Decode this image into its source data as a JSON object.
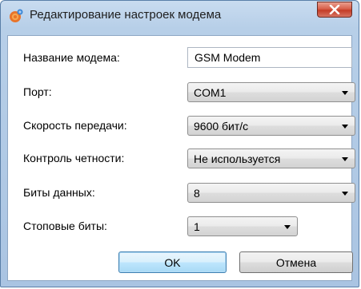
{
  "window": {
    "title": "Редактирование настроек модема",
    "close_icon": "close-x-icon",
    "app_icon": "modem-settings-icon"
  },
  "fields": {
    "modem_name_label": "Название модема:",
    "modem_name_value": "GSM Modem",
    "port_label": "Порт:",
    "port_value": "COM1",
    "baud_label": "Скорость передачи:",
    "baud_value": "9600 бит/с",
    "parity_label": "Контроль четности:",
    "parity_value": "Не используется",
    "data_bits_label": "Биты данных:",
    "data_bits_value": "8",
    "stop_bits_label": "Стоповые биты:",
    "stop_bits_value": "1"
  },
  "buttons": {
    "ok_label": "OK",
    "cancel_label": "Отмена"
  },
  "colors": {
    "title_bar": "#b7cfe8",
    "close_button": "#c43c26",
    "default_button_border": "#3c7fb1"
  }
}
